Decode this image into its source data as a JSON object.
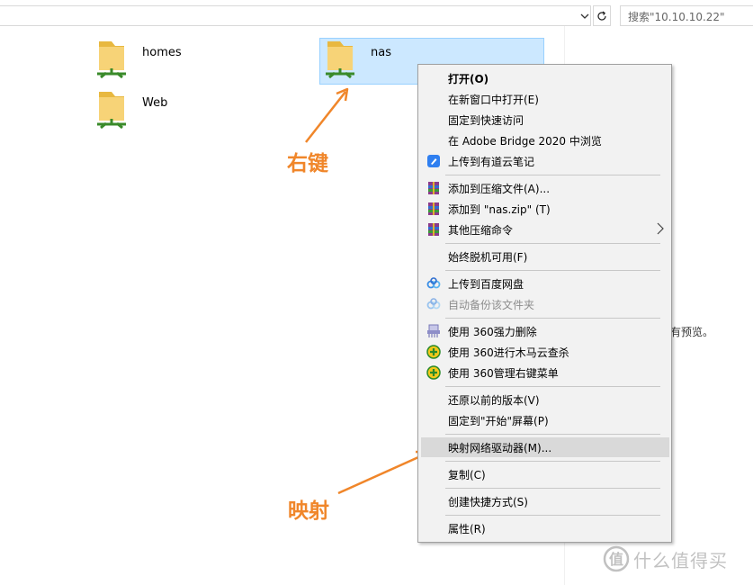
{
  "address_bar": {
    "search_placeholder": "搜索\"10.10.10.22\""
  },
  "folders": [
    {
      "name": "homes"
    },
    {
      "name": "Web"
    },
    {
      "name": "nas"
    }
  ],
  "preview_text": "有预览。",
  "context_menu": {
    "items": [
      {
        "label": "打开(O)"
      },
      {
        "label": "在新窗口中打开(E)"
      },
      {
        "label": "固定到快速访问"
      },
      {
        "label": "在 Adobe Bridge 2020 中浏览"
      },
      {
        "label": "上传到有道云笔记"
      },
      {
        "label": "添加到压缩文件(A)..."
      },
      {
        "label": "添加到 \"nas.zip\" (T)"
      },
      {
        "label": "其他压缩命令"
      },
      {
        "label": "始终脱机可用(F)"
      },
      {
        "label": "上传到百度网盘"
      },
      {
        "label": "自动备份该文件夹"
      },
      {
        "label": "使用 360强力删除"
      },
      {
        "label": "使用 360进行木马云查杀"
      },
      {
        "label": "使用 360管理右键菜单"
      },
      {
        "label": "还原以前的版本(V)"
      },
      {
        "label": "固定到\"开始\"屏幕(P)"
      },
      {
        "label": "映射网络驱动器(M)..."
      },
      {
        "label": "复制(C)"
      },
      {
        "label": "创建快捷方式(S)"
      },
      {
        "label": "属性(R)"
      }
    ]
  },
  "annotations": {
    "right_click": "右键",
    "map": "映射"
  },
  "watermark": {
    "text": "什么值得买"
  },
  "colors": {
    "annotation": "#f0862a",
    "selection_bg": "#cce8ff",
    "menu_bg": "#f2f2f2",
    "menu_highlight": "#d9d9d9"
  }
}
